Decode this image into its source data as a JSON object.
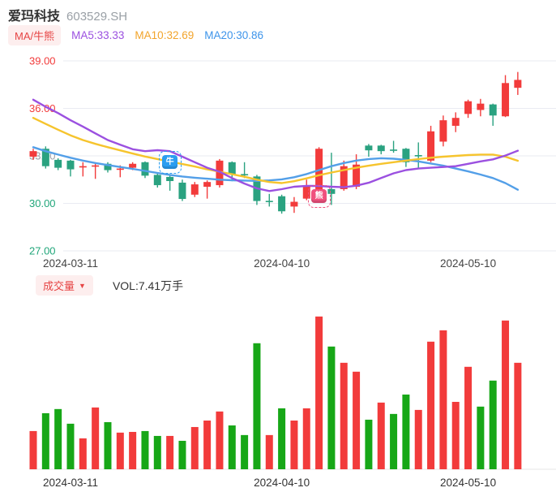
{
  "header": {
    "stock_name": "爱玛科技",
    "stock_code": "603529.SH",
    "ma_mode_badge": "MA/牛熊",
    "ma5_label": "MA5:33.33",
    "ma10_label": "MA10:32.69",
    "ma20_label": "MA20:30.86"
  },
  "volume_header": {
    "badge": "成交量",
    "dropdown_arrow": "▼",
    "vol_label": "VOL:7.41万手"
  },
  "colors": {
    "up": "#f23b3b",
    "down": "#2aa280",
    "vol_up": "#f23b3b",
    "vol_down": "#17a717",
    "ma5_line": "#9b50e0",
    "ma10_line": "#f6c42d",
    "ma20_line": "#539fe8",
    "grid": "#e9ebf2",
    "axis_text_dark": "#444444",
    "bull_marker": "#2b9df0",
    "bear_marker": "#f0517e"
  },
  "chart_data": {
    "type": "candlestick+volume",
    "title": "爱玛科技 603529.SH",
    "legend": [
      "MA/牛熊",
      "MA5:33.33",
      "MA10:32.69",
      "MA20:30.86"
    ],
    "y_ticks": [
      {
        "label": "39.00",
        "value": 39.0,
        "color": "#f23b3b"
      },
      {
        "label": "36.00",
        "value": 36.0,
        "color": "#f23b3b"
      },
      {
        "label": "33.00",
        "value": 33.0,
        "color": "#9aa0a6"
      },
      {
        "label": "30.00",
        "value": 30.0,
        "color": "#21a67a"
      },
      {
        "label": "27.00",
        "value": 27.0,
        "color": "#21a67a"
      }
    ],
    "x_ticks": [
      {
        "candle": 4,
        "label": "2024-03-11"
      },
      {
        "candle": 21,
        "label": "2024-04-10"
      },
      {
        "candle": 36,
        "label": "2024-05-10"
      }
    ],
    "candles_ohlc": [
      [
        32.95,
        33.45,
        32.75,
        33.3
      ],
      [
        33.45,
        33.6,
        32.2,
        32.35
      ],
      [
        32.75,
        32.85,
        32.1,
        32.25
      ],
      [
        32.7,
        32.75,
        31.7,
        32.15
      ],
      [
        32.3,
        32.6,
        31.7,
        32.35
      ],
      [
        32.35,
        32.55,
        31.55,
        32.4
      ],
      [
        32.5,
        32.6,
        31.95,
        32.1
      ],
      [
        32.15,
        32.4,
        31.65,
        32.2
      ],
      [
        32.25,
        32.6,
        32.1,
        32.5
      ],
      [
        32.6,
        32.65,
        31.6,
        31.75
      ],
      [
        31.8,
        31.9,
        31.0,
        31.15
      ],
      [
        31.67,
        31.75,
        30.8,
        31.41
      ],
      [
        31.31,
        31.5,
        30.15,
        30.28
      ],
      [
        30.55,
        31.35,
        30.4,
        31.2
      ],
      [
        31.05,
        31.45,
        30.3,
        31.35
      ],
      [
        31.15,
        32.8,
        31.0,
        32.7
      ],
      [
        32.6,
        32.65,
        31.4,
        31.85
      ],
      [
        31.85,
        32.6,
        31.6,
        31.8
      ],
      [
        31.7,
        31.8,
        29.9,
        30.15
      ],
      [
        30.16,
        30.6,
        29.8,
        30.13
      ],
      [
        30.45,
        30.55,
        29.35,
        29.5
      ],
      [
        29.8,
        30.4,
        29.4,
        30.1
      ],
      [
        30.3,
        31.5,
        30.2,
        31.05
      ],
      [
        30.9,
        33.55,
        30.7,
        33.45
      ],
      [
        30.9,
        33.2,
        29.9,
        30.6
      ],
      [
        30.9,
        32.7,
        30.8,
        32.35
      ],
      [
        31.05,
        33.1,
        30.9,
        32.45
      ],
      [
        33.65,
        33.75,
        32.95,
        33.35
      ],
      [
        33.65,
        33.7,
        33.1,
        33.3
      ],
      [
        33.4,
        33.95,
        33.2,
        33.35
      ],
      [
        33.45,
        33.5,
        32.3,
        32.6
      ],
      [
        33.05,
        33.85,
        32.2,
        33.0
      ],
      [
        32.7,
        34.9,
        32.6,
        34.55
      ],
      [
        33.9,
        35.55,
        33.6,
        35.25
      ],
      [
        34.9,
        35.75,
        34.5,
        35.4
      ],
      [
        35.65,
        36.55,
        35.4,
        36.45
      ],
      [
        35.9,
        36.6,
        35.5,
        36.3
      ],
      [
        36.25,
        36.3,
        34.9,
        35.55
      ],
      [
        35.5,
        38.1,
        35.45,
        37.6
      ],
      [
        37.3,
        38.3,
        36.85,
        37.8
      ]
    ],
    "volumes_wanshou": [
      2.66,
      3.9,
      4.19,
      3.17,
      2.15,
      4.3,
      3.28,
      2.55,
      2.6,
      2.66,
      2.32,
      2.32,
      1.98,
      2.94,
      3.39,
      4.02,
      3.05,
      2.38,
      8.77,
      2.38,
      4.24,
      3.39,
      4.24,
      10.63,
      8.54,
      7.41,
      6.79,
      3.45,
      4.64,
      3.85,
      5.2,
      4.13,
      8.88,
      9.67,
      4.69,
      7.13,
      4.36,
      6.17,
      10.35,
      7.41
    ],
    "volume_colors": [
      "red",
      "green",
      "green",
      "green",
      "red",
      "red",
      "green",
      "red",
      "red",
      "green",
      "green",
      "red",
      "green",
      "red",
      "red",
      "red",
      "green",
      "green",
      "green",
      "red",
      "green",
      "red",
      "red",
      "red",
      "green",
      "red",
      "red",
      "green",
      "red",
      "green",
      "green",
      "red",
      "red",
      "red",
      "red",
      "red",
      "green",
      "green",
      "red",
      "red"
    ],
    "ma5": [
      36.55,
      36.1,
      35.7,
      35.25,
      34.85,
      34.42,
      34.0,
      33.7,
      33.42,
      33.3,
      33.36,
      33.3,
      32.95,
      32.6,
      32.25,
      32.0,
      31.6,
      31.25,
      30.95,
      30.78,
      30.9,
      31.05,
      31.1,
      31.1,
      31.05,
      31.02,
      31.12,
      31.3,
      31.6,
      31.9,
      32.1,
      32.2,
      32.25,
      32.3,
      32.35,
      32.5,
      32.65,
      32.78,
      33.02,
      33.33
    ],
    "ma10": [
      35.4,
      35.02,
      34.65,
      34.3,
      34.0,
      33.76,
      33.55,
      33.35,
      33.15,
      32.96,
      32.8,
      32.64,
      32.48,
      32.33,
      32.15,
      32.0,
      31.84,
      31.68,
      31.5,
      31.35,
      31.28,
      31.4,
      31.58,
      31.78,
      31.95,
      32.1,
      32.25,
      32.38,
      32.5,
      32.6,
      32.7,
      32.8,
      32.88,
      32.95,
      33.0,
      33.05,
      33.08,
      33.08,
      32.95,
      32.69
    ],
    "ma20": [
      33.55,
      33.3,
      33.08,
      32.88,
      32.7,
      32.55,
      32.42,
      32.3,
      32.18,
      32.05,
      31.92,
      31.8,
      31.7,
      31.62,
      31.56,
      31.5,
      31.46,
      31.44,
      31.42,
      31.45,
      31.52,
      31.65,
      31.85,
      32.1,
      32.35,
      32.55,
      32.7,
      32.8,
      32.85,
      32.82,
      32.75,
      32.65,
      32.52,
      32.38,
      32.2,
      32.02,
      31.82,
      31.6,
      31.28,
      30.86
    ],
    "markers": [
      {
        "type": "bull",
        "glyph": "牛",
        "candle": 12,
        "price": 32.6
      },
      {
        "type": "bear",
        "glyph": "熊",
        "candle": 24,
        "price": 30.45
      }
    ],
    "y_range": [
      27.0,
      39.0
    ],
    "grid": true,
    "latest_volume_label": "VOL:7.41万手"
  }
}
